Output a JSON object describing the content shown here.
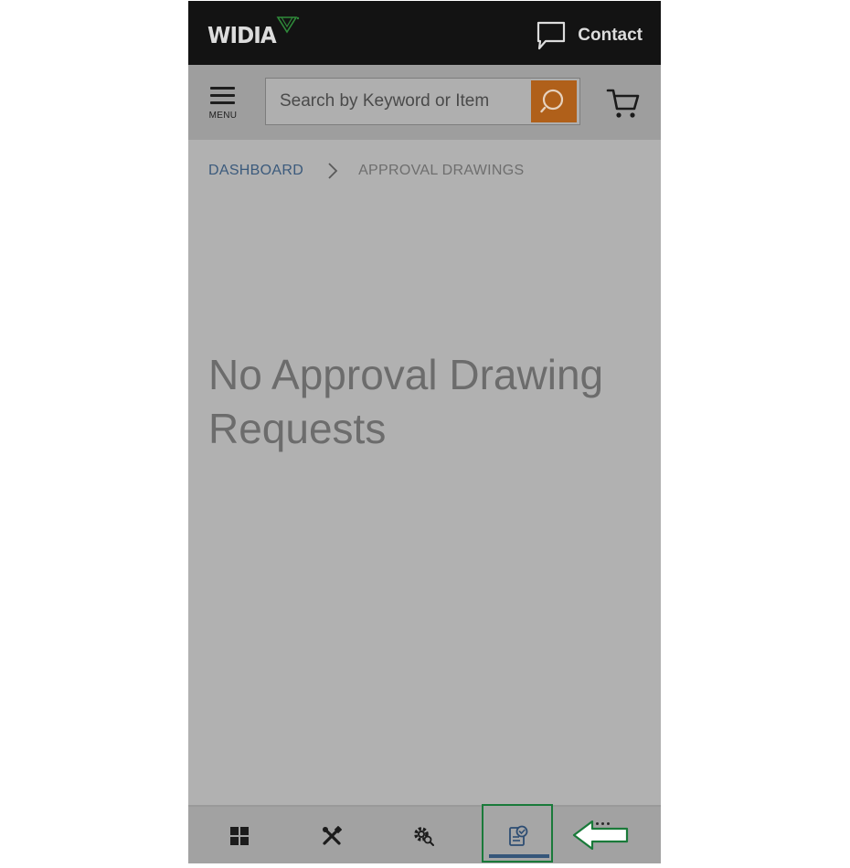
{
  "header": {
    "brand": "WIDIA",
    "contact_label": "Contact"
  },
  "search": {
    "menu_label": "MENU",
    "placeholder": "Search by Keyword or Item"
  },
  "breadcrumb": {
    "items": [
      "DASHBOARD",
      "APPROVAL DRAWINGS"
    ]
  },
  "main": {
    "empty_message": "No Approval Drawing Requests"
  },
  "bottom_nav": {
    "items": [
      {
        "icon": "dashboard-grid-icon"
      },
      {
        "icon": "tools-icon"
      },
      {
        "icon": "gear-search-icon"
      },
      {
        "icon": "approval-drawing-icon",
        "active": true
      },
      {
        "icon": "more-icon"
      }
    ]
  },
  "colors": {
    "topbar": "#131313",
    "search_button": "#b0601a",
    "link": "#3b5a7c",
    "highlight_box": "#1a7a3a",
    "active_indicator": "#35567a"
  }
}
